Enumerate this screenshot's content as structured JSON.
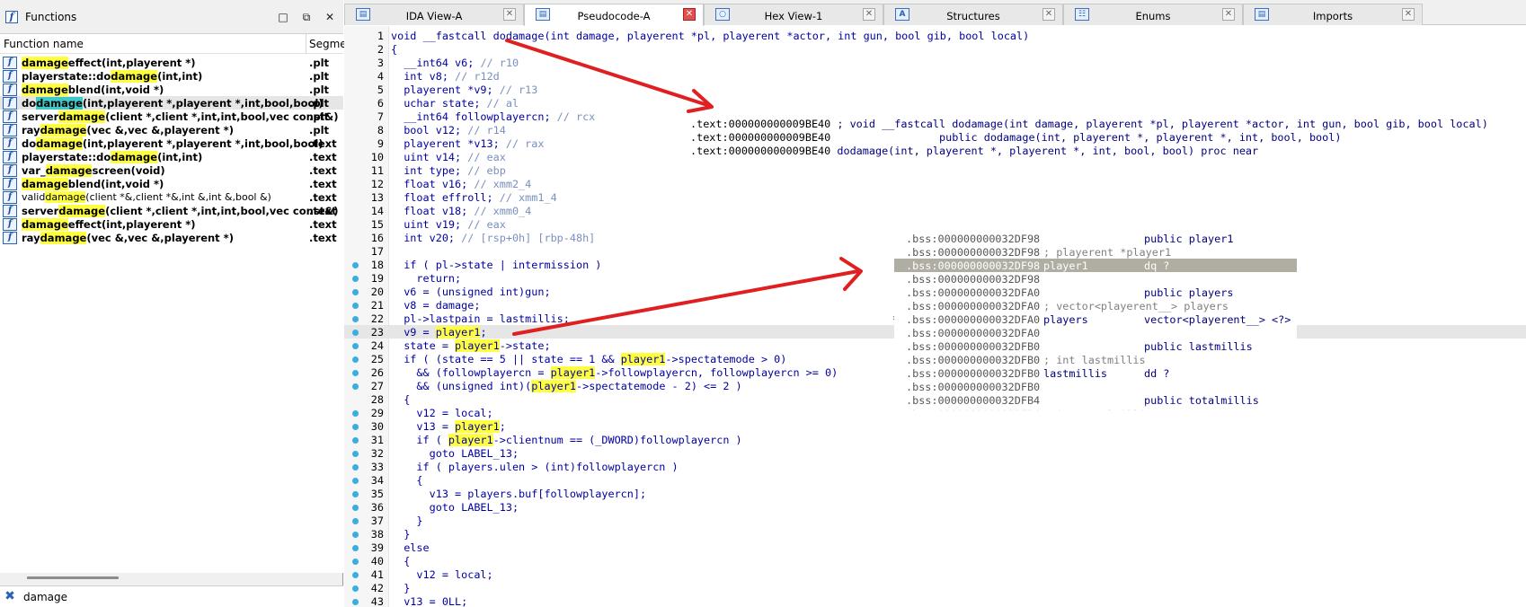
{
  "functions_panel": {
    "title": "Functions",
    "buttons": {
      "minimize": "□",
      "restore": "⧉",
      "close": "✕"
    },
    "headers": {
      "name": "Function name",
      "segment": "Segme"
    },
    "rows": [
      {
        "pre": "",
        "hl": "damage",
        "post": "effect(int,playerent *)",
        "seg": ".plt"
      },
      {
        "pre": "playerstate::do",
        "hl": "damage",
        "post": "(int,int)",
        "seg": ".plt"
      },
      {
        "pre": "",
        "hl": "damage",
        "post": "blend(int,void *)",
        "seg": ".plt"
      },
      {
        "pre": "do",
        "hl": "damage",
        "post": "(int,playerent *,playerent *,int,bool,bool)",
        "seg": ".plt"
      },
      {
        "pre": "server",
        "hl": "damage",
        "post": "(client *,client *,int,int,bool,vec const&)",
        "seg": ".plt"
      },
      {
        "pre": "ray",
        "hl": "damage",
        "post": "(vec &,vec &,playerent *)",
        "seg": ".plt"
      },
      {
        "pre": "do",
        "hl": "damage",
        "post": "(int,playerent *,playerent *,int,bool,bool)",
        "seg": ".text"
      },
      {
        "pre": "playerstate::do",
        "hl": "damage",
        "post": "(int,int)",
        "seg": ".text"
      },
      {
        "pre": "var_",
        "hl": "damage",
        "post": "screen(void)",
        "seg": ".text"
      },
      {
        "pre": "",
        "hl": "damage",
        "post": "blend(int,void *)",
        "seg": ".text"
      },
      {
        "pre": "valid",
        "hl": "damage",
        "post": "(client *&,client *&,int &,int &,bool &)",
        "seg": ".text"
      },
      {
        "pre": "server",
        "hl": "damage",
        "post": "(client *,client *,int,int,bool,vec const&)",
        "seg": ".text"
      },
      {
        "pre": "",
        "hl": "damage",
        "post": "effect(int,playerent *)",
        "seg": ".text"
      },
      {
        "pre": "ray",
        "hl": "damage",
        "post": "(vec &,vec &,playerent *)",
        "seg": ".text"
      }
    ],
    "filter": {
      "value": "damage",
      "icon": "✖"
    }
  },
  "tabs": [
    {
      "label": "IDA View-A",
      "icon": "▤",
      "close": "✕"
    },
    {
      "label": "Pseudocode-A",
      "icon": "▤",
      "close": "✕"
    },
    {
      "label": "Hex View-1",
      "icon": "○",
      "close": "✕"
    },
    {
      "label": "Structures",
      "icon": "A",
      "close": "✕"
    },
    {
      "label": "Enums",
      "icon": "☷",
      "close": "✕"
    },
    {
      "label": "Imports",
      "icon": "▤",
      "close": "✕"
    }
  ],
  "pseudocode": [
    {
      "n": "1",
      "t": "void __fastcall dodamage(int damage, playerent *pl, playerent *actor, int gun, bool gib, bool local)"
    },
    {
      "n": "2",
      "t": "{"
    },
    {
      "n": "3",
      "t": "  __int64 v6; ",
      "c": "// r10"
    },
    {
      "n": "4",
      "t": "  int v8; ",
      "c": "// r12d"
    },
    {
      "n": "5",
      "t": "  playerent *v9; ",
      "c": "// r13"
    },
    {
      "n": "6",
      "t": "  uchar state; ",
      "c": "// al"
    },
    {
      "n": "7",
      "t": "  __int64 followplayercn; ",
      "c": "// rcx"
    },
    {
      "n": "8",
      "t": "  bool v12; ",
      "c": "// r14"
    },
    {
      "n": "9",
      "t": "  playerent *v13; ",
      "c": "// rax"
    },
    {
      "n": "10",
      "t": "  uint v14; ",
      "c": "// eax"
    },
    {
      "n": "11",
      "t": "  int type; ",
      "c": "// ebp"
    },
    {
      "n": "12",
      "t": "  float v16; ",
      "c": "// xmm2_4"
    },
    {
      "n": "13",
      "t": "  float effroll; ",
      "c": "// xmm1_4"
    },
    {
      "n": "14",
      "t": "  float v18; ",
      "c": "// xmm0_4"
    },
    {
      "n": "15",
      "t": "  uint v19; ",
      "c": "// eax"
    },
    {
      "n": "16",
      "t": "  int v20; ",
      "c": "// [rsp+0h] [rbp-48h]"
    },
    {
      "n": "17",
      "t": ""
    },
    {
      "n": "18",
      "t": "  if ( pl->state | intermission )"
    },
    {
      "n": "19",
      "t": "    return;"
    },
    {
      "n": "20",
      "t": "  v6 = (unsigned int)gun;"
    },
    {
      "n": "21",
      "t": "  v8 = damage;"
    },
    {
      "n": "22",
      "t": "  pl->lastpain = lastmillis;"
    },
    {
      "n": "23",
      "t": "  v9 = player1;"
    },
    {
      "n": "24",
      "t": "  state = player1->state;"
    },
    {
      "n": "25",
      "t": "  if ( (state == 5 || state == 1 && player1->spectatemode > 0)"
    },
    {
      "n": "26",
      "t": "    && (followplayercn = player1->followplayercn, followplayercn >= 0)"
    },
    {
      "n": "27",
      "t": "    && (unsigned int)(player1->spectatemode - 2) <= 2 )"
    },
    {
      "n": "28",
      "t": "  {"
    },
    {
      "n": "29",
      "t": "    v12 = local;"
    },
    {
      "n": "30",
      "t": "    v13 = player1;"
    },
    {
      "n": "31",
      "t": "    if ( player1->clientnum == (_DWORD)followplayercn )"
    },
    {
      "n": "32",
      "t": "      goto LABEL_13;"
    },
    {
      "n": "33",
      "t": "    if ( players.ulen > (int)followplayercn )"
    },
    {
      "n": "34",
      "t": "    {"
    },
    {
      "n": "35",
      "t": "      v13 = players.buf[followplayercn];"
    },
    {
      "n": "36",
      "t": "      goto LABEL_13;"
    },
    {
      "n": "37",
      "t": "    }"
    },
    {
      "n": "38",
      "t": "  }"
    },
    {
      "n": "39",
      "t": "  else"
    },
    {
      "n": "40",
      "t": "  {"
    },
    {
      "n": "41",
      "t": "    v12 = local;"
    },
    {
      "n": "42",
      "t": "  }"
    },
    {
      "n": "43",
      "t": "  v13 = 0LL;"
    }
  ],
  "asm_hint": [
    {
      "addr": ".text:000000000009BE40",
      "text": " ; void __fastcall dodamage(int damage, playerent *pl, playerent *actor, int gun, bool gib, bool local)"
    },
    {
      "addr": ".text:000000000009BE40",
      "text": "                 public dodamage(int, playerent *, playerent *, int, bool, bool)"
    },
    {
      "addr": ".text:000000000009BE40",
      "text": " dodamage(int, playerent *, playerent *, int, bool, bool) proc near"
    }
  ],
  "bss_hint": [
    {
      "addr": ".bss:000000000032DF98",
      "pub": "public player1"
    },
    {
      "addr": ".bss:000000000032DF98",
      "cmt": "; playerent *player1"
    },
    {
      "addr": ".bss:000000000032DF98",
      "lbl": "player1",
      "ins": "dq ?",
      "sel": true
    },
    {
      "addr": ".bss:000000000032DF98"
    },
    {
      "addr": ".bss:000000000032DFA0",
      "pub": "public players"
    },
    {
      "addr": ".bss:000000000032DFA0",
      "cmt": "; vector<playerent__> players"
    },
    {
      "addr": ".bss:000000000032DFA0",
      "lbl": "players",
      "ins": "vector<playerent__> <?>"
    },
    {
      "addr": ".bss:000000000032DFA0"
    },
    {
      "addr": ".bss:000000000032DFB0",
      "pub": "public lastmillis"
    },
    {
      "addr": ".bss:000000000032DFB0",
      "cmt": "; int lastmillis"
    },
    {
      "addr": ".bss:000000000032DFB0",
      "lbl": "lastmillis",
      "ins": "dd ?"
    },
    {
      "addr": ".bss:000000000032DFB0"
    },
    {
      "addr": ".bss:000000000032DFB4",
      "pub": "public totalmillis"
    },
    {
      "addr": ".bss:000000000032DFB4",
      "cmt": "; int totalmilli"
    }
  ],
  "colors": {
    "highlight": "#ffff40",
    "current_function": "#3ec9c9",
    "annotation_arrow": "#e02020",
    "breakpoint_dot": "#3aaede"
  }
}
